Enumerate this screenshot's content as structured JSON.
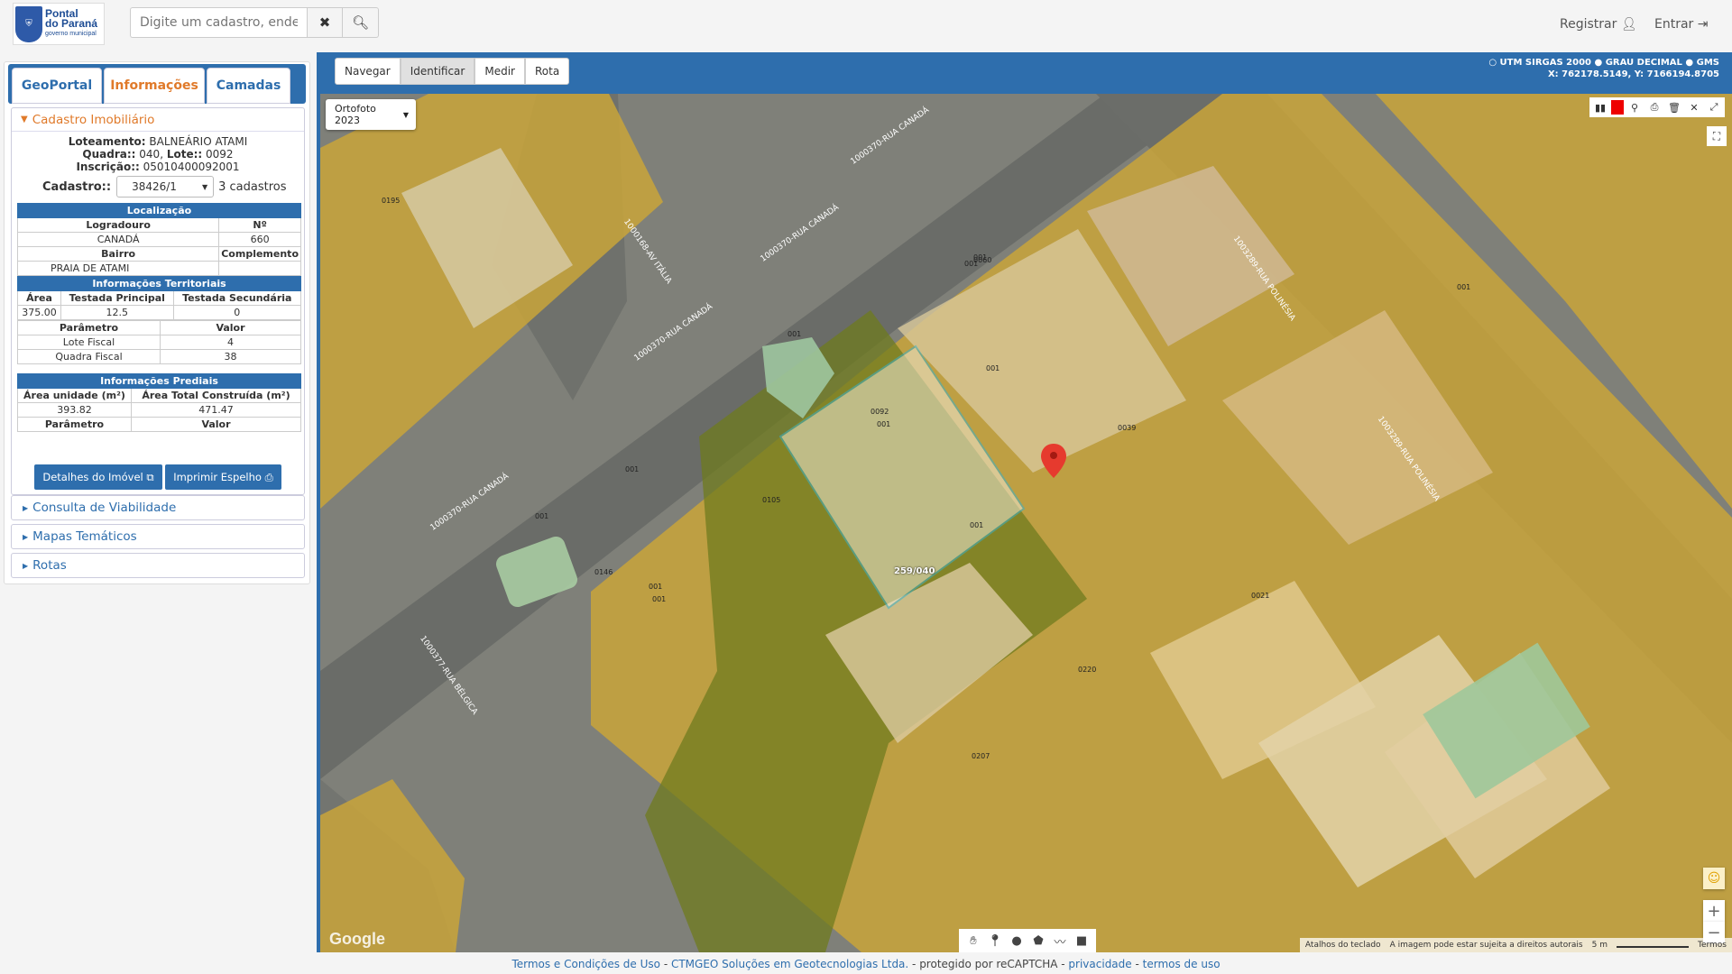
{
  "header": {
    "logo_line1": "Pontal",
    "logo_line2": "do Paraná",
    "logo_line3": "governo municipal",
    "search_placeholder": "Digite um cadastro, endereço...",
    "register": "Registrar",
    "login": "Entrar"
  },
  "tabs": [
    "GeoPortal",
    "Informações",
    "Camadas"
  ],
  "cadastro": {
    "heading": "Cadastro Imobiliário",
    "loteamento_label": "Loteamento:",
    "loteamento": "BALNEÁRIO ATAMI",
    "quadra_label": "Quadra::",
    "quadra": "040",
    "lote_label": "Lote::",
    "lote": "0092",
    "inscricao_label": "Inscrição::",
    "inscricao": "05010400092001",
    "cadastro_label": "Cadastro::",
    "cadastro_value": "38426/1",
    "cadastro_count": "3 cadastros",
    "localizacao": {
      "caption": "Localização",
      "h1": "Logradouro",
      "h2": "Nº",
      "logradouro": "CANADÁ",
      "numero": "660",
      "h3": "Bairro",
      "h4": "Complemento",
      "bairro": "PRAIA DE ATAMI",
      "complemento": ""
    },
    "territoriais": {
      "caption": "Informações Territoriais",
      "h1": "Área",
      "h2": "Testada Principal",
      "h3": "Testada Secundária",
      "area": "375.00",
      "testada_principal": "12.5",
      "testada_secundaria": "0",
      "p_h1": "Parâmetro",
      "p_h2": "Valor",
      "r1_label": "Lote Fiscal",
      "r1_value": "4",
      "r2_label": "Quadra Fiscal",
      "r2_value": "38"
    },
    "prediais": {
      "caption": "Informações Prediais",
      "h1": "Área unidade (m²)",
      "h2": "Área Total Construída (m²)",
      "area_unidade": "393.82",
      "area_total": "471.47",
      "p_h1": "Parâmetro",
      "p_h2": "Valor"
    },
    "btn_detalhes": "Detalhes do Imóvel",
    "btn_imprimir": "Imprimir Espelho"
  },
  "accordions": [
    "Consulta de Viabilidade",
    "Mapas Temáticos",
    "Rotas"
  ],
  "map": {
    "tools": [
      "Navegar",
      "Identificar",
      "Medir",
      "Rota"
    ],
    "active_tool": "Identificar",
    "crs_options": [
      "UTM SIRGAS 2000",
      "GRAU DECIMAL",
      "GMS"
    ],
    "coords": "X: 762178.5149, Y: 7166194.8705",
    "basemap": "Ortofoto 2023",
    "street_labels": [
      "1000370-RUA CANADÁ",
      "1000370-RUA CANADÁ",
      "1000370-RUA CANADÁ",
      "1000370-RUA CANADÁ",
      "1000168-AV ITÁLIA",
      "1003289-RUA POLINÉSIA",
      "1003289-RUA POLINÉSIA",
      "1000377-RUA BÉLGICA"
    ],
    "lot_labels": [
      "0195",
      "0060",
      "001",
      "001",
      "001",
      "001",
      "0092",
      "001",
      "0039",
      "001",
      "001",
      "0105",
      "001",
      "0146",
      "001",
      "001",
      "259/040",
      "0021",
      "0220",
      "0207",
      "001"
    ],
    "attrib": [
      "Atalhos do teclado",
      "A imagem pode estar sujeita a direitos autorais",
      "5 m",
      "Termos"
    ],
    "google": "Google",
    "accent": "#2e6ead",
    "highlight": "#e07a2a"
  },
  "footer": {
    "link1": "Termos e Condições de Uso",
    "sep1": " - ",
    "link2": "CTMGEO Soluções em Geotecnologias Ltda.",
    "text": " - protegido por reCAPTCHA - ",
    "link3": "privacidade",
    "sep2": " - ",
    "link4": "termos de uso"
  }
}
